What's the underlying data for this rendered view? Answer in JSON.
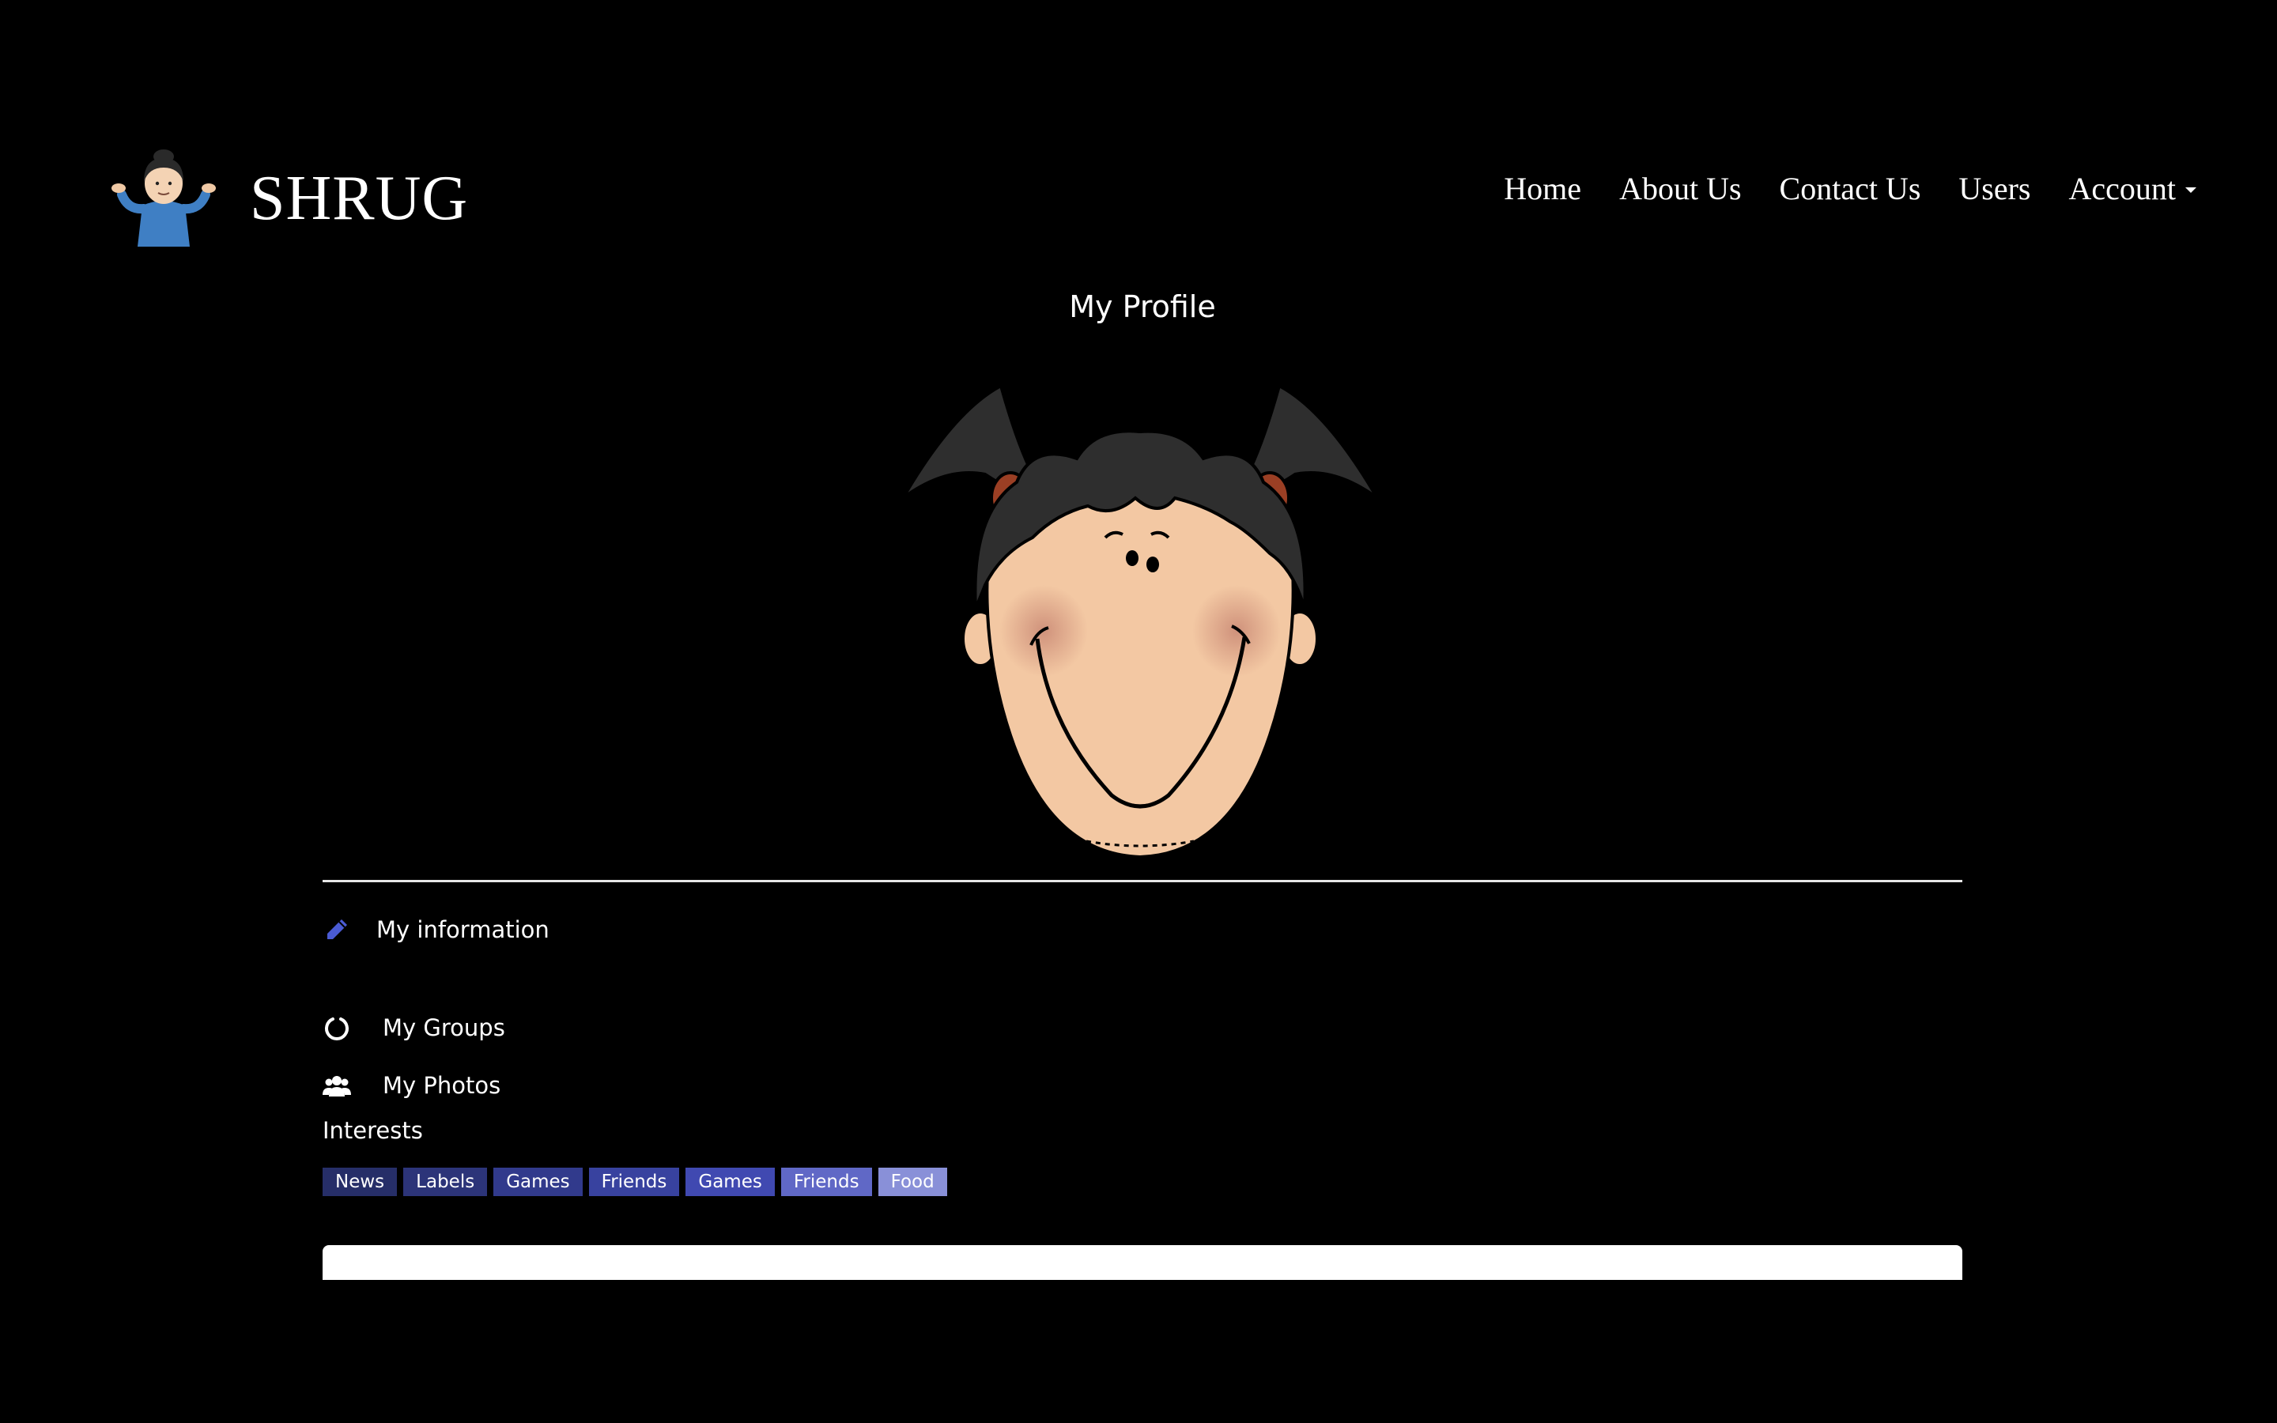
{
  "brand": {
    "name": "SHRUG",
    "logo": "shrugging-person-icon"
  },
  "nav": {
    "items": [
      {
        "label": "Home"
      },
      {
        "label": "About Us"
      },
      {
        "label": "Contact Us"
      },
      {
        "label": "Users"
      },
      {
        "label": "Account",
        "has_dropdown": true
      }
    ]
  },
  "page": {
    "title": "My Profile"
  },
  "avatar": {
    "icon": "cartoon-girl-avatar"
  },
  "profile_links": {
    "info": {
      "label": "My information",
      "icon": "pencil-icon",
      "icon_color": "#4a5bd4"
    },
    "groups": {
      "label": "My Groups",
      "icon": "circle-notch-icon"
    },
    "photos": {
      "label": "My Photos",
      "icon": "users-icon"
    }
  },
  "interests": {
    "heading": "Interests",
    "tags": [
      {
        "label": "News",
        "color": "#262e68"
      },
      {
        "label": "Labels",
        "color": "#2c3479"
      },
      {
        "label": "Games",
        "color": "#313a8c"
      },
      {
        "label": "Friends",
        "color": "#38429f"
      },
      {
        "label": "Games",
        "color": "#4049b1"
      },
      {
        "label": "Friends",
        "color": "#6068c6"
      },
      {
        "label": "Food",
        "color": "#8990d8"
      }
    ]
  },
  "colors": {
    "background": "#000000",
    "text": "#ffffff",
    "accent": "#4a5bd4"
  }
}
